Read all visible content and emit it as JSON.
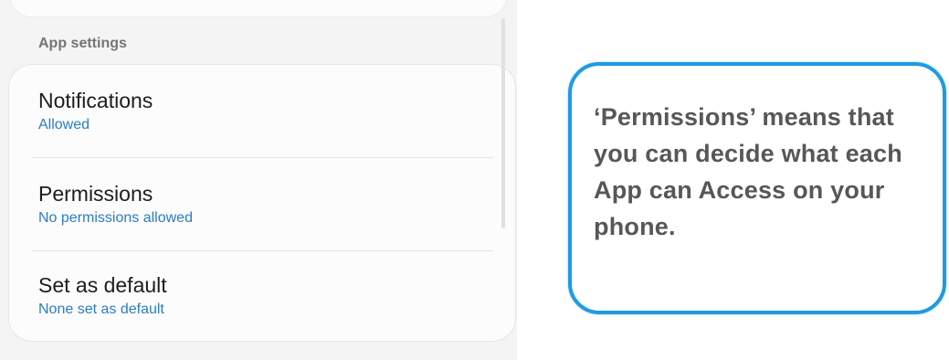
{
  "settings_panel": {
    "section_header": "App settings",
    "items": [
      {
        "title": "Notifications",
        "subtitle": "Allowed"
      },
      {
        "title": "Permissions",
        "subtitle": "No permissions allowed"
      },
      {
        "title": "Set as default",
        "subtitle": "None set as default"
      }
    ]
  },
  "callout": {
    "text": "‘Permissions’ means that you can decide what each App can Access on your phone."
  },
  "colors": {
    "subtitle": "#2c7cc3",
    "callout_border": "#1e9be3",
    "panel_background": "#f4f4f4"
  }
}
